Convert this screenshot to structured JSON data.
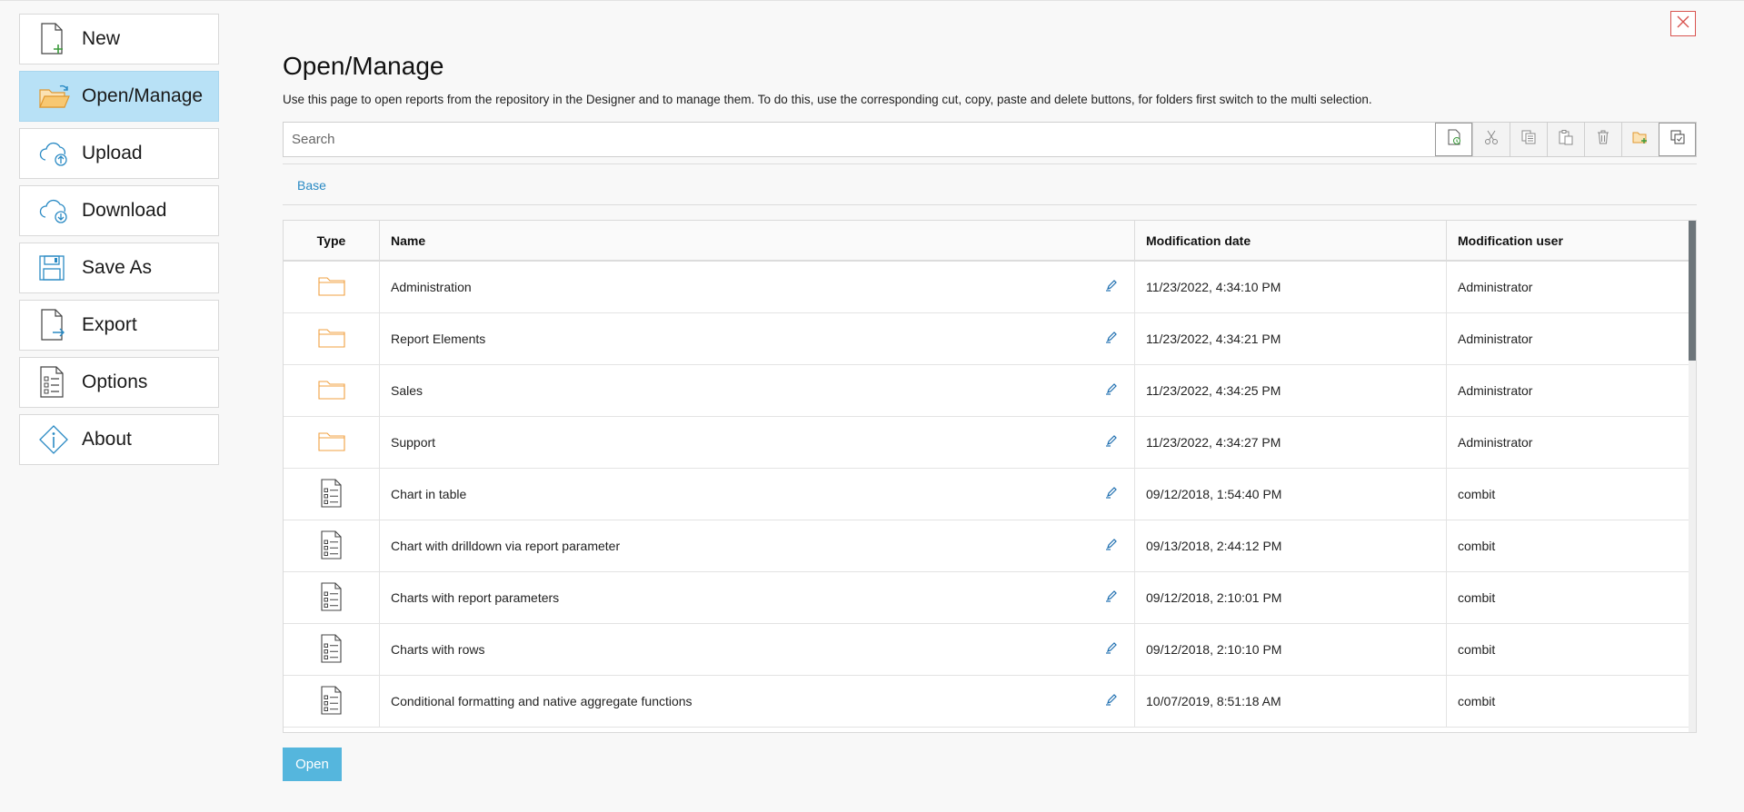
{
  "sidebar": {
    "items": [
      {
        "label": "New",
        "icon": "new-document-icon"
      },
      {
        "label": "Open/Manage",
        "icon": "open-folder-icon",
        "active": true
      },
      {
        "label": "Upload",
        "icon": "cloud-upload-icon"
      },
      {
        "label": "Download",
        "icon": "cloud-download-icon"
      },
      {
        "label": "Save As",
        "icon": "floppy-disk-icon"
      },
      {
        "label": "Export",
        "icon": "export-document-icon"
      },
      {
        "label": "Options",
        "icon": "options-list-icon"
      },
      {
        "label": "About",
        "icon": "info-diamond-icon"
      }
    ]
  },
  "page": {
    "title": "Open/Manage",
    "description": "Use this page to open reports from the repository in the Designer and to manage them. To do this, use the corresponding cut, copy, paste and delete buttons, for folders first switch to the multi selection."
  },
  "search": {
    "placeholder": "Search"
  },
  "breadcrumb": {
    "base": "Base"
  },
  "table": {
    "headers": {
      "type": "Type",
      "name": "Name",
      "date": "Modification date",
      "user": "Modification user"
    },
    "rows": [
      {
        "type": "folder",
        "name": "Administration",
        "date": "11/23/2022, 4:34:10 PM",
        "user": "Administrator"
      },
      {
        "type": "folder",
        "name": "Report Elements",
        "date": "11/23/2022, 4:34:21 PM",
        "user": "Administrator"
      },
      {
        "type": "folder",
        "name": "Sales",
        "date": "11/23/2022, 4:34:25 PM",
        "user": "Administrator"
      },
      {
        "type": "folder",
        "name": "Support",
        "date": "11/23/2022, 4:34:27 PM",
        "user": "Administrator"
      },
      {
        "type": "report",
        "name": "Chart in table",
        "date": "09/12/2018, 1:54:40 PM",
        "user": "combit"
      },
      {
        "type": "report",
        "name": "Chart with drilldown via report parameter",
        "date": "09/13/2018, 2:44:12 PM",
        "user": "combit"
      },
      {
        "type": "report",
        "name": "Charts with report parameters",
        "date": "09/12/2018, 2:10:01 PM",
        "user": "combit"
      },
      {
        "type": "report",
        "name": "Charts with rows",
        "date": "09/12/2018, 2:10:10 PM",
        "user": "combit"
      },
      {
        "type": "report",
        "name": "Conditional formatting and native aggregate functions",
        "date": "10/07/2019, 8:51:18 AM",
        "user": "combit"
      }
    ]
  },
  "actions": {
    "open_label": "Open"
  },
  "colors": {
    "accent": "#55b6dd",
    "active_bg": "#b8e1f6",
    "folder": "#f0a040",
    "link": "#2a8ac4",
    "close": "#d9534f"
  }
}
